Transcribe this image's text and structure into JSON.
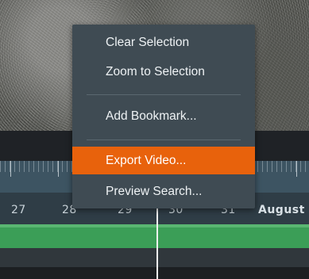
{
  "context_menu": {
    "items": [
      {
        "label": "Clear Selection",
        "highlighted": false
      },
      {
        "label": "Zoom to Selection",
        "highlighted": false
      },
      {
        "label": "Add Bookmark...",
        "highlighted": false
      },
      {
        "label": "Export Video...",
        "highlighted": true
      },
      {
        "label": "Preview Search...",
        "highlighted": false
      }
    ],
    "highlight_color": "#e8620c"
  },
  "timeline": {
    "dates": [
      "27",
      "28",
      "29",
      "30",
      "31",
      "August"
    ],
    "track_color": "#3b9e57"
  }
}
